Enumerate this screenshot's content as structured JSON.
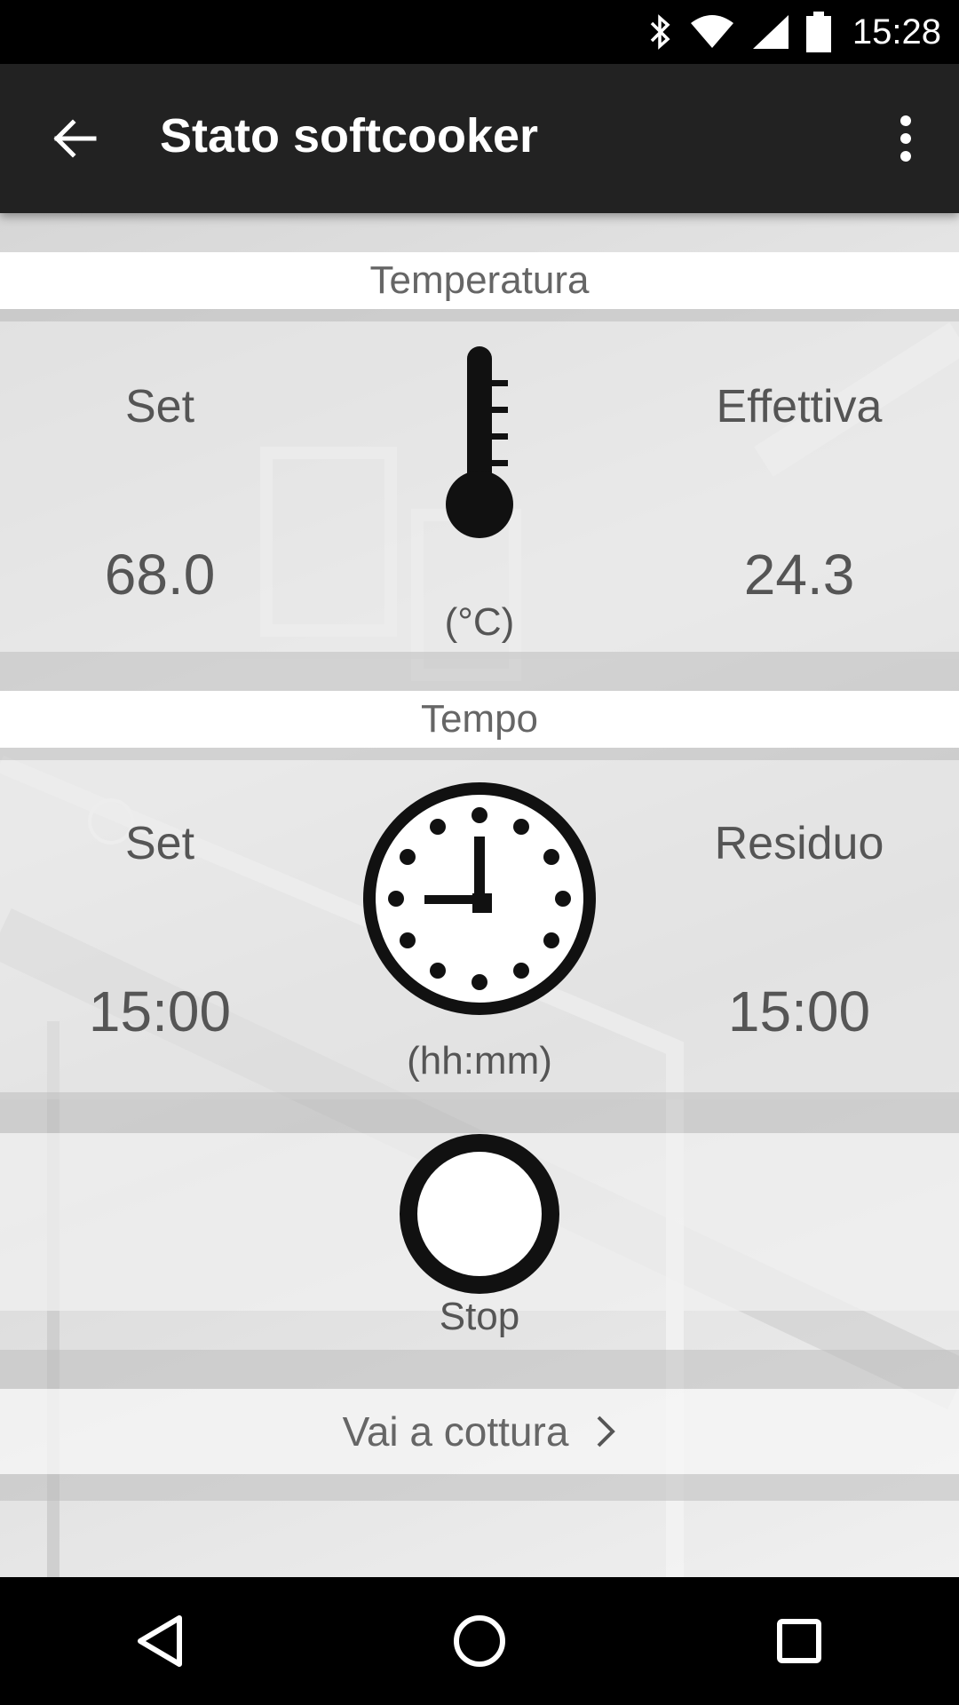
{
  "status_bar": {
    "time": "15:28",
    "icons": [
      "bluetooth-icon",
      "wifi-icon",
      "signal-icon",
      "battery-icon"
    ]
  },
  "app_bar": {
    "title": "Stato softcooker",
    "back_icon": "arrow-back-icon",
    "menu_icon": "more-vert-icon"
  },
  "temperature": {
    "header": "Temperatura",
    "set_label": "Set",
    "set_value": "68.0",
    "actual_label": "Effettiva",
    "actual_value": "24.3",
    "unit": "(°C)",
    "icon": "thermometer-icon"
  },
  "time": {
    "header": "Tempo",
    "set_label": "Set",
    "set_value": "15:00",
    "remaining_label": "Residuo",
    "remaining_value": "15:00",
    "unit": "(hh:mm)",
    "icon": "clock-icon"
  },
  "stop": {
    "label": "Stop",
    "icon": "circle-stop-icon"
  },
  "goto_cooking": {
    "label": "Vai a cottura",
    "icon": "chevron-right-icon"
  },
  "nav_bar": {
    "icons": [
      "back-triangle-icon",
      "home-circle-icon",
      "recents-square-icon"
    ]
  },
  "colors": {
    "status_bar": "#000000",
    "app_bar": "#222222",
    "text": "#555555"
  }
}
